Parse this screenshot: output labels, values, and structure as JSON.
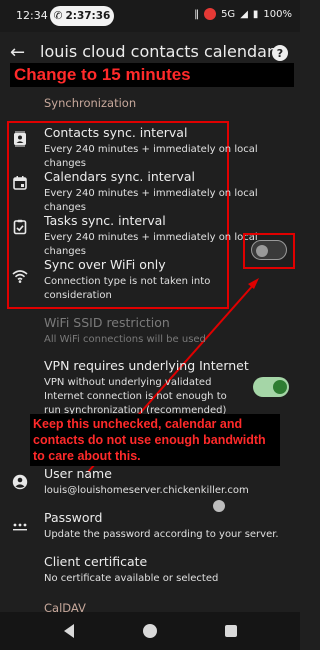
{
  "status_bar": {
    "time": "12:34",
    "call_timer": "2:37:36",
    "network": "5G",
    "battery": "100%"
  },
  "app_bar": {
    "title": "louis cloud contacts calendar"
  },
  "annotations": {
    "banner": "Change to 15 minutes",
    "note": "Keep this unchecked, calendar and contacts do not use enough bandwidth to care about this.",
    "color": "#ff2a2a"
  },
  "sync": {
    "section_title": "Synchronization",
    "contacts_title": "Contacts sync. interval",
    "contacts_summary": "Every 240 minutes + immediately on local changes",
    "calendars_title": "Calendars sync. interval",
    "calendars_summary": "Every 240 minutes + immediately on local changes",
    "tasks_title": "Tasks sync. interval",
    "tasks_summary": "Every 240 minutes + immediately on local changes",
    "wifi_only_title": "Sync over WiFi only",
    "wifi_only_summary": "Connection type is not taken into consideration",
    "wifi_only_checked": false,
    "ssid_title": "WiFi SSID restriction",
    "ssid_summary": "All WiFi connections will be used",
    "vpn_title": "VPN requires underlying Internet",
    "vpn_summary": "VPN without underlying validated Internet connection is not enough to run synchronization (recommended)",
    "vpn_checked": true
  },
  "auth": {
    "username_title": "User name",
    "username_value": "louis@louishomeserver.chickenkiller.com",
    "password_title": "Password",
    "password_summary": "Update the password according to your server.",
    "cert_title": "Client certificate",
    "cert_summary": "No certificate available or selected"
  },
  "caldav": {
    "section_title": "CalDAV"
  },
  "colors": {
    "accent_on": "#2e7d32",
    "accent_track_on": "#a5d6a7",
    "section": "#c7a89b"
  }
}
